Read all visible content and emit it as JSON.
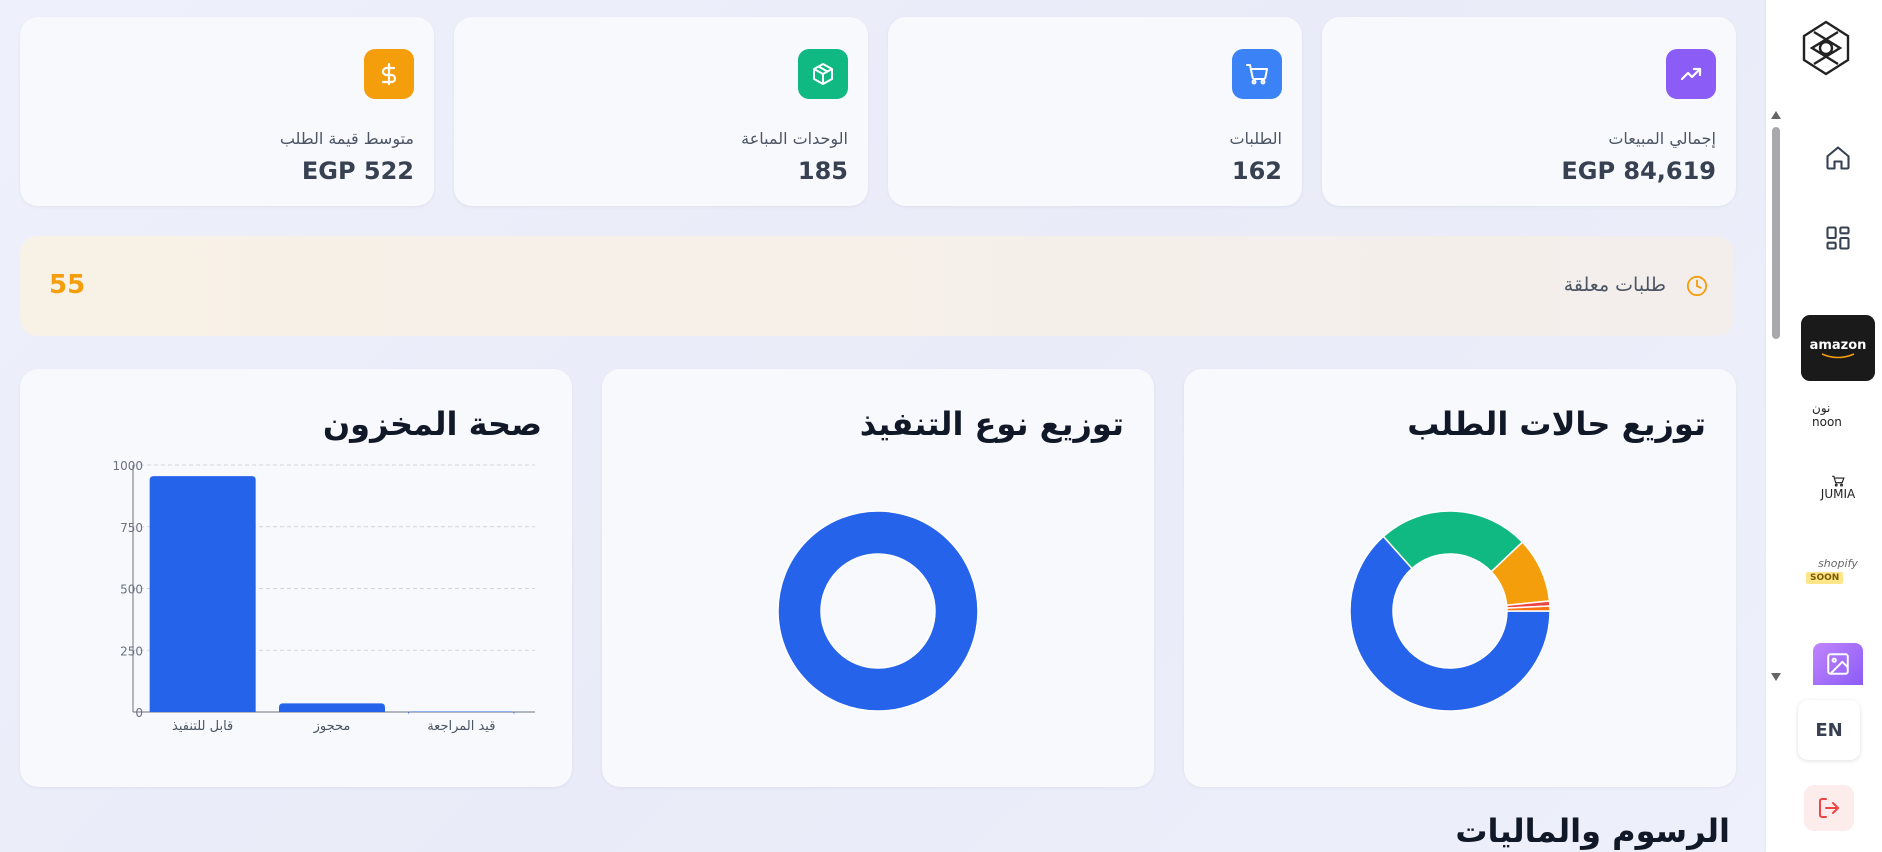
{
  "stats": [
    {
      "label": "إجمالي المبيعات",
      "value": "EGP 84,619",
      "icon": "trending-up-icon",
      "color": "#8b5cf6"
    },
    {
      "label": "الطلبات",
      "value": "162",
      "icon": "cart-icon",
      "color": "#3b82f6"
    },
    {
      "label": "الوحدات المباعة",
      "value": "185",
      "icon": "package-icon",
      "color": "#10b981"
    },
    {
      "label": "متوسط قيمة الطلب",
      "value": "EGP 522",
      "icon": "dollar-icon",
      "color": "#f59e0b"
    }
  ],
  "pending": {
    "label": "طلبات معلقة",
    "value": "55",
    "icon": "clock-icon",
    "color": "#f59e0b"
  },
  "charts": {
    "order_status_title": "توزيع حالات الطلب",
    "fulfillment_title": "توزيع نوع التنفيذ",
    "inventory_title": "صحة المخزون"
  },
  "chart_data": [
    {
      "type": "pie",
      "title": "توزيع حالات الطلب",
      "values": [
        63.4,
        24.5,
        10.5,
        0.8,
        0.8
      ],
      "colors": [
        "#2563eb",
        "#10b981",
        "#f59e0b",
        "#ef4444",
        "#f97316"
      ]
    },
    {
      "type": "pie",
      "title": "توزيع نوع التنفيذ",
      "values": [
        100
      ],
      "colors": [
        "#2563eb"
      ]
    },
    {
      "type": "bar",
      "title": "صحة المخزون",
      "categories": [
        "قابل للتنفيذ",
        "محجوز",
        "قيد المراجعة"
      ],
      "values": [
        955,
        35,
        2
      ],
      "ylim": [
        0,
        1000
      ],
      "yticks": [
        "0",
        "250",
        "500",
        "750",
        "1000"
      ],
      "color": "#2563eb",
      "grid": true
    }
  ],
  "section_title": "الرسوم والماليات",
  "sidebar": {
    "logo": "app-logo",
    "amazon": "amazon",
    "noon": "نون noon",
    "jumia": "JUMIA",
    "shopify": "shopify",
    "shopify_badge": "SOON",
    "lang": "EN"
  },
  "colors": {
    "accent": "#2563eb",
    "logout": "#ef4444"
  }
}
